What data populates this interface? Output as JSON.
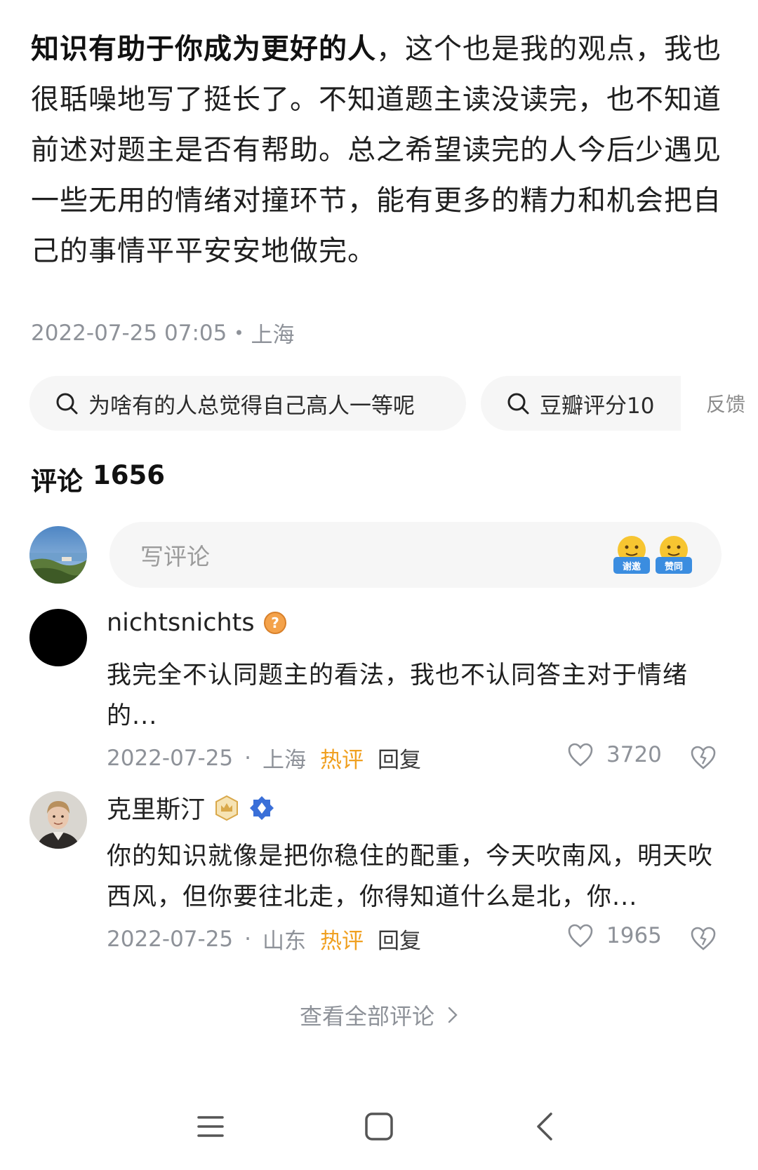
{
  "answer": {
    "bold_lead": "知识有助于你成为更好的人",
    "body": "，这个也是我的观点，我也很聒噪地写了挺长了。不知道题主读没读完，也不知道前述对题主是否有帮助。总之希望读完的人今后少遇见一些无用的情绪对撞环节，能有更多的精力和机会把自己的事情平平安安地做完。",
    "datetime": "2022-07-25 07:05",
    "location": "上海"
  },
  "related_search": {
    "chip1": "为啥有的人总觉得自己高人一等呢",
    "chip2": "豆瓣评分10",
    "feedback": "反馈"
  },
  "comments": {
    "title": "评论",
    "count": "1656",
    "write_placeholder": "写评论",
    "emoji1_tag": "谢邀",
    "emoji2_tag": "赞同",
    "items": [
      {
        "name": "nichtsnichts",
        "text": "我完全不认同题主的看法，我也不认同答主对于情绪的...",
        "date": "2022-07-25",
        "location": "上海",
        "hot": "热评",
        "reply": "回复",
        "likes": "3720"
      },
      {
        "name": "克里斯汀",
        "text": "你的知识就像是把你稳住的配重，今天吹南风，明天吹西风，但你要往北走，你得知道什么是北，你...",
        "date": "2022-07-25",
        "location": "山东",
        "hot": "热评",
        "reply": "回复",
        "likes": "1965"
      }
    ],
    "view_all": "查看全部评论"
  },
  "colors": {
    "hot": "#f0a020",
    "muted": "#8e9299",
    "chip_bg": "#f6f6f6",
    "verified_blue": "#3a6fd8"
  },
  "icons": {
    "search": "search-icon",
    "heart": "heart-icon",
    "dislike": "broken-heart-icon",
    "menu": "menu-icon",
    "home": "home-square-icon",
    "back": "back-chevron-icon"
  }
}
